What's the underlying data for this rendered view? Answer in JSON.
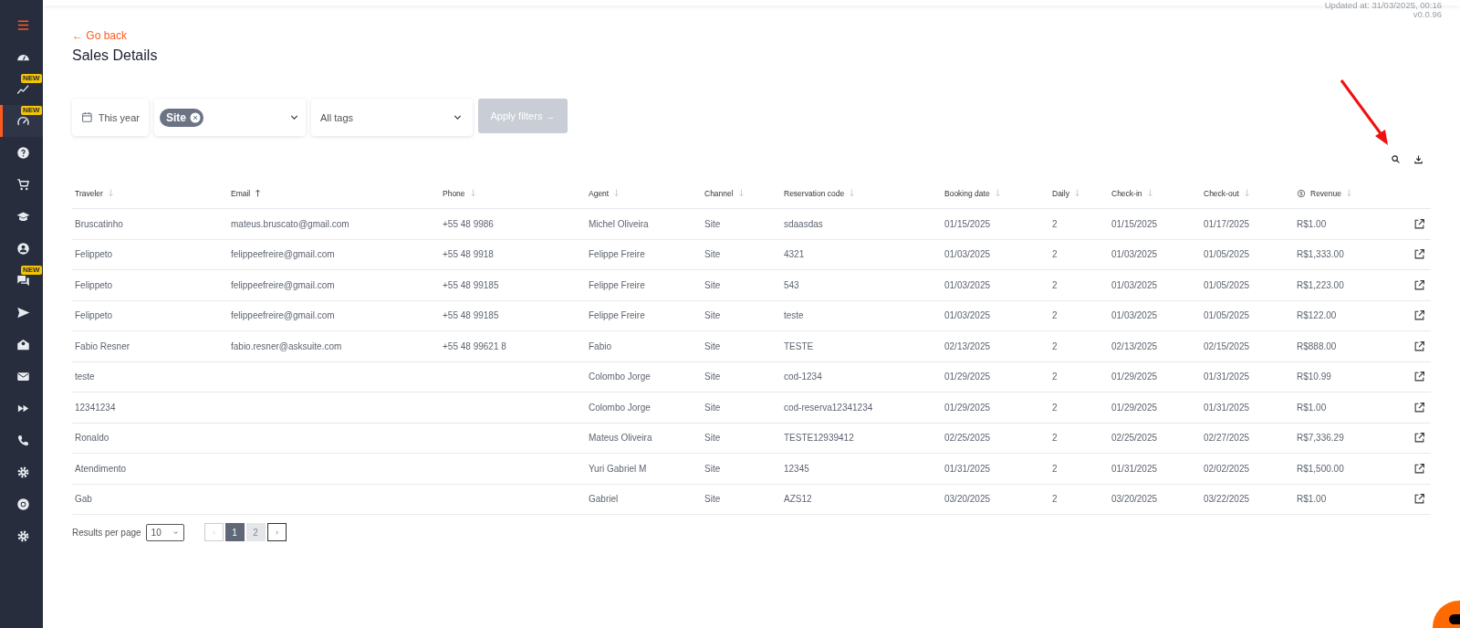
{
  "sidebar": {
    "items": [
      {
        "kind": "menu",
        "selected": false
      },
      {
        "kind": "dashboard",
        "selected": false
      },
      {
        "kind": "chart",
        "selected": false,
        "badge": "NEW"
      },
      {
        "kind": "gauge",
        "selected": true,
        "badge": "NEW"
      },
      {
        "kind": "help",
        "selected": false
      },
      {
        "kind": "cart",
        "selected": false
      },
      {
        "kind": "school",
        "selected": false
      },
      {
        "kind": "user",
        "selected": false
      },
      {
        "kind": "chat",
        "selected": false,
        "badge": "NEW"
      },
      {
        "kind": "send",
        "selected": false
      },
      {
        "kind": "mail-open",
        "selected": false
      },
      {
        "kind": "mail",
        "selected": false
      },
      {
        "kind": "forward",
        "selected": false
      },
      {
        "kind": "phone",
        "selected": false
      },
      {
        "kind": "gear",
        "selected": false
      },
      {
        "kind": "lifebuoy",
        "selected": false
      },
      {
        "kind": "gear",
        "selected": false
      }
    ]
  },
  "header": {
    "updated": "Updated at: 31/03/2025, 00:16",
    "version": "v0.0.96"
  },
  "back_link": "← Go back",
  "title": "Sales Details",
  "filters": {
    "date": "This year",
    "channel_chip": "Site",
    "tags": "All tags",
    "apply": "Apply filters →",
    "apply_disabled": true
  },
  "annotation": {
    "kind": "arrow"
  },
  "table": {
    "columns": [
      {
        "label": "Traveler",
        "sort_ascending": false,
        "sort_active": false
      },
      {
        "label": "Email",
        "sort_ascending": true,
        "sort_active": true
      },
      {
        "label": "Phone",
        "sort_ascending": false,
        "sort_active": false
      },
      {
        "label": "Agent",
        "sort_ascending": false,
        "sort_active": false
      },
      {
        "label": "Channel",
        "sort_ascending": false,
        "sort_active": false
      },
      {
        "label": "Reservation code",
        "sort_ascending": false,
        "sort_active": false
      },
      {
        "label": "Booking date",
        "sort_ascending": false,
        "sort_active": false
      },
      {
        "label": "Daily",
        "sort_ascending": false,
        "sort_active": false
      },
      {
        "label": "Check-in",
        "sort_ascending": false,
        "sort_active": false
      },
      {
        "label": "Check-out",
        "sort_ascending": false,
        "sort_active": false
      },
      {
        "label": "Revenue",
        "sort_ascending": false,
        "sort_active": false,
        "kind": "currency"
      }
    ],
    "rows": [
      [
        "Bruscatinho",
        "mateus.bruscato@gmail.com",
        "+55 48 9986",
        "Michel Oliveira",
        "Site",
        "sdaasdas",
        "01/15/2025",
        "2",
        "01/15/2025",
        "01/17/2025",
        "R$1.00"
      ],
      [
        "Felippeto",
        "felippeefreire@gmail.com",
        "+55 48 9918",
        "Felippe Freire",
        "Site",
        "4321",
        "01/03/2025",
        "2",
        "01/03/2025",
        "01/05/2025",
        "R$1,333.00"
      ],
      [
        "Felippeto",
        "felippeefreire@gmail.com",
        "+55 48 99185",
        "Felippe Freire",
        "Site",
        "543",
        "01/03/2025",
        "2",
        "01/03/2025",
        "01/05/2025",
        "R$1,223.00"
      ],
      [
        "Felippeto",
        "felippeefreire@gmail.com",
        "+55 48 99185",
        "Felippe Freire",
        "Site",
        "teste",
        "01/03/2025",
        "2",
        "01/03/2025",
        "01/05/2025",
        "R$122.00"
      ],
      [
        "Fabio Resner",
        "fabio.resner@asksuite.com",
        "+55 48 99621 8",
        "Fabio",
        "Site",
        "TESTE",
        "02/13/2025",
        "2",
        "02/13/2025",
        "02/15/2025",
        "R$888.00"
      ],
      [
        "teste",
        "",
        "",
        "Colombo Jorge",
        "Site",
        "cod-1234",
        "01/29/2025",
        "2",
        "01/29/2025",
        "01/31/2025",
        "R$10.99"
      ],
      [
        "12341234",
        "",
        "",
        "Colombo Jorge",
        "Site",
        "cod-reserva12341234",
        "01/29/2025",
        "2",
        "01/29/2025",
        "01/31/2025",
        "R$1.00"
      ],
      [
        "Ronaldo",
        "",
        "",
        "Mateus Oliveira",
        "Site",
        "TESTE12939412",
        "02/25/2025",
        "2",
        "02/25/2025",
        "02/27/2025",
        "R$7,336.29"
      ],
      [
        "Atendimento",
        "",
        "",
        "Yuri Gabriel M",
        "Site",
        "12345",
        "01/31/2025",
        "2",
        "01/31/2025",
        "02/02/2025",
        "R$1,500.00"
      ],
      [
        "Gab",
        "",
        "",
        "Gabriel",
        "Site",
        "AZS12",
        "03/20/2025",
        "2",
        "03/20/2025",
        "03/22/2025",
        "R$1.00"
      ]
    ]
  },
  "pagination": {
    "label": "Results per page",
    "per_page": "10",
    "pages": [
      {
        "label": "1",
        "selected": true
      },
      {
        "label": "2",
        "selected": false
      }
    ]
  }
}
